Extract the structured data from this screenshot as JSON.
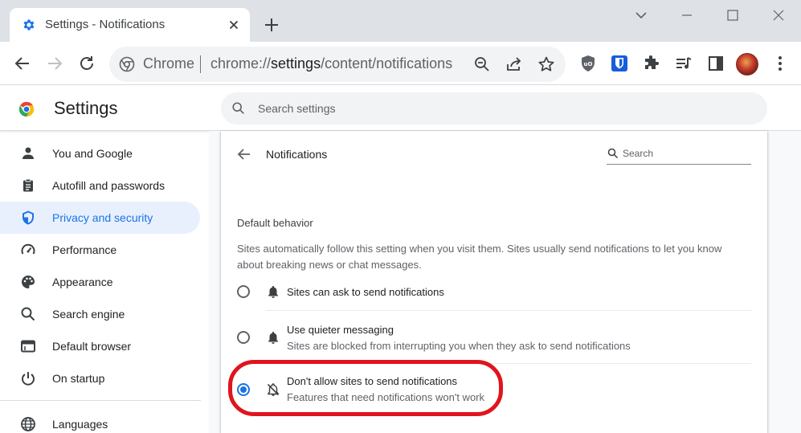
{
  "tab": {
    "title": "Settings - Notifications"
  },
  "omnibox": {
    "site_label": "Chrome",
    "url_host": "chrome://",
    "url_path_main": "settings",
    "url_path_rest": "/content/notifications"
  },
  "header": {
    "title": "Settings",
    "search_placeholder": "Search settings"
  },
  "sidebar": {
    "items": [
      {
        "label": "You and Google",
        "icon": "person-icon"
      },
      {
        "label": "Autofill and passwords",
        "icon": "clipboard-icon"
      },
      {
        "label": "Privacy and security",
        "icon": "shield-icon",
        "active": true
      },
      {
        "label": "Performance",
        "icon": "speedometer-icon"
      },
      {
        "label": "Appearance",
        "icon": "palette-icon"
      },
      {
        "label": "Search engine",
        "icon": "search-icon"
      },
      {
        "label": "Default browser",
        "icon": "browser-window-icon"
      },
      {
        "label": "On startup",
        "icon": "power-icon"
      },
      {
        "label": "Languages",
        "icon": "globe-icon"
      }
    ]
  },
  "page": {
    "title": "Notifications",
    "search_placeholder": "Search",
    "section_title": "Default behavior",
    "section_desc": "Sites automatically follow this setting when you visit them. Sites usually send notifications to let you know about breaking news or chat messages.",
    "options": [
      {
        "label": "Sites can ask to send notifications",
        "sublabel": "",
        "checked": false,
        "icon": "bell-icon"
      },
      {
        "label": "Use quieter messaging",
        "sublabel": "Sites are blocked from interrupting you when they ask to send notifications",
        "checked": false,
        "icon": "bell-icon"
      },
      {
        "label": "Don't allow sites to send notifications",
        "sublabel": "Features that need notifications won't work",
        "checked": true,
        "icon": "bell-off-icon"
      }
    ]
  },
  "colors": {
    "accent": "#1a73e8",
    "highlight": "#e0141e",
    "active_nav_bg": "#e8f0fe"
  }
}
